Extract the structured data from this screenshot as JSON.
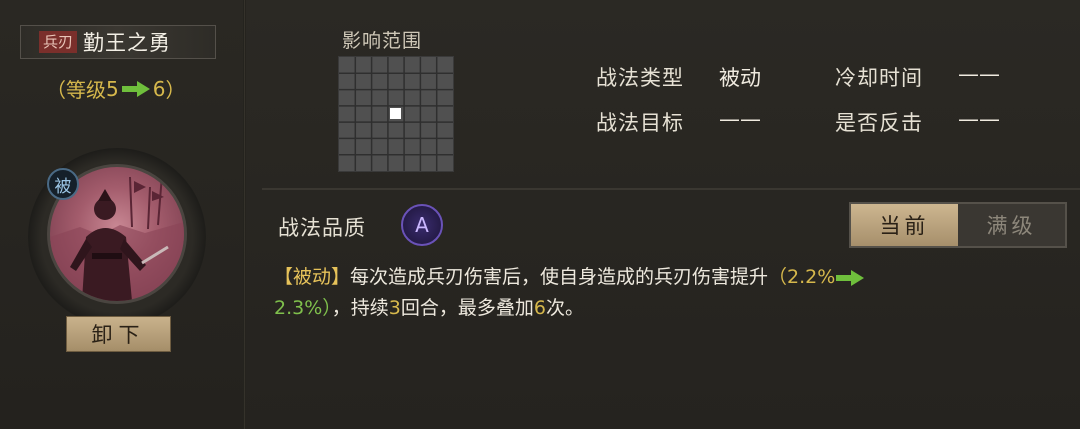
{
  "skill": {
    "type_tag": "兵刃",
    "name": "勤王之勇",
    "level_open": "（等级",
    "level_from": "5",
    "level_to": "6",
    "level_close": "）",
    "passive_badge": "被",
    "unequip_label": "卸下"
  },
  "range": {
    "label": "影响范围",
    "grid_size": 7
  },
  "info": {
    "type_label": "战法类型",
    "type_value": "被动",
    "cooldown_label": "冷却时间",
    "cooldown_value": "——",
    "target_label": "战法目标",
    "target_value": "——",
    "counter_label": "是否反击",
    "counter_value": "——"
  },
  "quality": {
    "label": "战法品质",
    "grade": "A"
  },
  "toggle": {
    "current_label": "当前",
    "max_label": "满级"
  },
  "description": {
    "tag": "【被动】",
    "text_1": "每次造成兵刃伤害后，使自身造成的兵刃伤害提升",
    "paren_open": "（",
    "old_value": "2.2%",
    "new_value": "2.3%）",
    "text_2": "，持续",
    "duration": "3",
    "text_3": "回合，最多叠加",
    "stacks": "6",
    "text_4": "次。"
  },
  "colors": {
    "level": "#d6b84c",
    "increase": "#7fc04c",
    "tag": "#e6c25a",
    "quality_a": "#6a52b8"
  },
  "icons": {
    "level_arrow": "green-arrow-icon",
    "quality": "grade-a-icon",
    "badge": "passive-badge-icon"
  }
}
